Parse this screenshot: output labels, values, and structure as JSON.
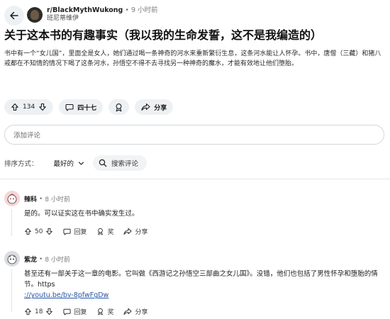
{
  "header": {
    "subreddit": "r/BlackMythWukong",
    "time": "9 小时前",
    "author": "班尼蒂维伊"
  },
  "post": {
    "title": "关于这本书的有趣事实（我以我的生命发誓，这不是我编造的）",
    "body": "书中有一个“女儿国”，里面全是女人，她们通过喝一条神奇的河水来重新繁衍生息，这条河水能让人怀孕。书中，唐僧（三藏）和猪八戒都在不知情的情况下喝了这条河水，孙悟空不得不去寻找另一种神奇的魔水，才能有效地让他们堕胎。",
    "votes": "134",
    "comments_label": "四十七",
    "share_label": "分享"
  },
  "comment_input": {
    "placeholder": "添加评论"
  },
  "sort": {
    "label": "排序方式：",
    "value": "最好的",
    "search_label": "搜索评论"
  },
  "comments": [
    {
      "user": "辣科",
      "time": "8 小时前",
      "text": "是的。可以证实这在书中确实发生过。",
      "votes": "50",
      "reply_label": "回复",
      "award_label": "奖",
      "share_label": "分享"
    },
    {
      "user": "紫龙",
      "time": "8 小时前",
      "text": "甚至还有一部关于这一章的电影。它叫做《西游记之孙悟空三部曲之女儿国》。没错，他们也包括了男性怀孕和堕胎的情节。https",
      "link": "://youtu.be/bv-8pfwFgDw",
      "votes": "18",
      "reply_label": "回复",
      "award_label": "奖",
      "share_label": "分享"
    }
  ],
  "colors": {
    "pill_bg": "#eef1f3",
    "link": "#2755a5",
    "avatar1": "#f7d5d7",
    "avatar2": "#d9dde2"
  }
}
